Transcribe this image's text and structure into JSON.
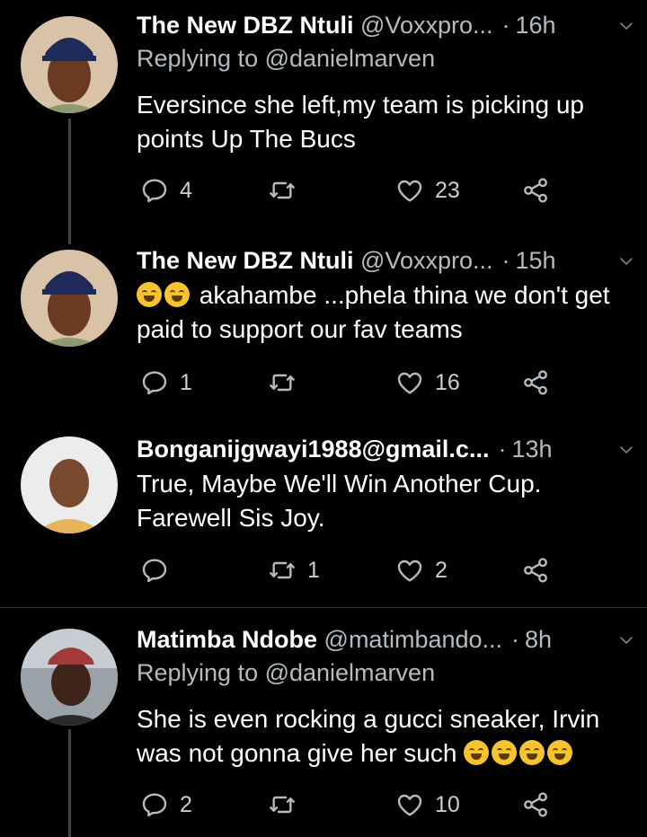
{
  "tweets": [
    {
      "name": "The New DBZ Ntuli",
      "handle": "@Voxxpro...",
      "time": "16h",
      "replying_to": "Replying to @danielmarven",
      "text": "Eversince she left,my team is picking up points Up The Bucs",
      "replies": "4",
      "retweets": "",
      "likes": "23",
      "avatar_desc": "man-in-cap"
    },
    {
      "name": "The New DBZ Ntuli",
      "handle": "@Voxxpro...",
      "time": "15h",
      "text_prefix_emoji": [
        "rofl-emoji",
        "rofl-emoji"
      ],
      "text": "akahambe ...phela thina we don't get paid to support our fav teams",
      "replies": "1",
      "retweets": "",
      "likes": "16",
      "avatar_desc": "man-in-cap"
    },
    {
      "name": "Bonganijgwayi1988@gmail.c...",
      "handle": "",
      "time": "13h",
      "text": "True, Maybe We'll Win Another Cup. Farewell Sis Joy.",
      "replies": "",
      "retweets": "1",
      "likes": "2",
      "avatar_desc": "man-portrait"
    },
    {
      "name": "Matimba Ndobe",
      "handle": "@matimbando...",
      "time": "8h",
      "replying_to": "Replying to @danielmarven",
      "text": "She is even rocking a gucci sneaker, Irvin was not gonna give her such",
      "text_suffix_emoji": [
        "rofl-emoji",
        "rofl-emoji",
        "rofl-emoji",
        "rofl-emoji"
      ],
      "replies": "2",
      "retweets": "",
      "likes": "10",
      "avatar_desc": "man-in-red-cap"
    }
  ],
  "colors": {
    "background": "#000000",
    "secondary_text": "#b4bcc2",
    "divider": "#2f3336"
  }
}
